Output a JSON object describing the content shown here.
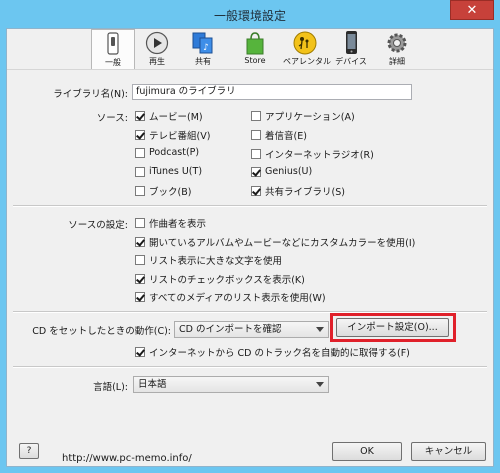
{
  "window": {
    "title": "一般環境設定",
    "close_glyph": "✕"
  },
  "toolbar": [
    {
      "label": "一般",
      "icon": "general-switch-icon"
    },
    {
      "label": "再生",
      "icon": "play-icon"
    },
    {
      "label": "共有",
      "icon": "sharing-icon"
    },
    {
      "label": "Store",
      "icon": "store-bag-icon"
    },
    {
      "label": "ペアレンタル",
      "icon": "parental-icon"
    },
    {
      "label": "デバイス",
      "icon": "device-icon"
    },
    {
      "label": "詳細",
      "icon": "gear-icon"
    }
  ],
  "library": {
    "label": "ライブラリ名(N):",
    "value": "fujimura のライブラリ"
  },
  "sources": {
    "label": "ソース:",
    "items": [
      {
        "label": "ムービー(M)",
        "checked": true
      },
      {
        "label": "アプリケーション(A)",
        "checked": false
      },
      {
        "label": "テレビ番組(V)",
        "checked": true
      },
      {
        "label": "着信音(E)",
        "checked": false
      },
      {
        "label": "Podcast(P)",
        "checked": false
      },
      {
        "label": "インターネットラジオ(R)",
        "checked": false
      },
      {
        "label": "iTunes U(T)",
        "checked": false
      },
      {
        "label": "Genius(U)",
        "checked": true
      },
      {
        "label": "ブック(B)",
        "checked": false
      },
      {
        "label": "共有ライブラリ(S)",
        "checked": true
      }
    ]
  },
  "source_settings": {
    "label": "ソースの設定:",
    "items": [
      {
        "label": "作曲者を表示",
        "checked": false
      },
      {
        "label": "開いているアルバムやムービーなどにカスタムカラーを使用(I)",
        "checked": true
      },
      {
        "label": "リスト表示に大きな文字を使用",
        "checked": false
      },
      {
        "label": "リストのチェックボックスを表示(K)",
        "checked": true
      },
      {
        "label": "すべてのメディアのリスト表示を使用(W)",
        "checked": true
      }
    ]
  },
  "cd": {
    "label": "CD をセットしたときの動作(C):",
    "select_value": "CD のインポートを確認",
    "import_button": "インポート設定(O)...",
    "auto_fetch_label": "インターネットから CD のトラック名を自動的に取得する(F)",
    "auto_fetch_checked": true
  },
  "language": {
    "label": "言語(L):",
    "value": "日本語"
  },
  "footer": {
    "help": "?",
    "ok": "OK",
    "cancel": "キャンセル",
    "url": "http://www.pc-memo.info/"
  },
  "colors": {
    "highlight": "#e0202a",
    "titlebar": "#6cc6f0",
    "close": "#c7413a"
  }
}
